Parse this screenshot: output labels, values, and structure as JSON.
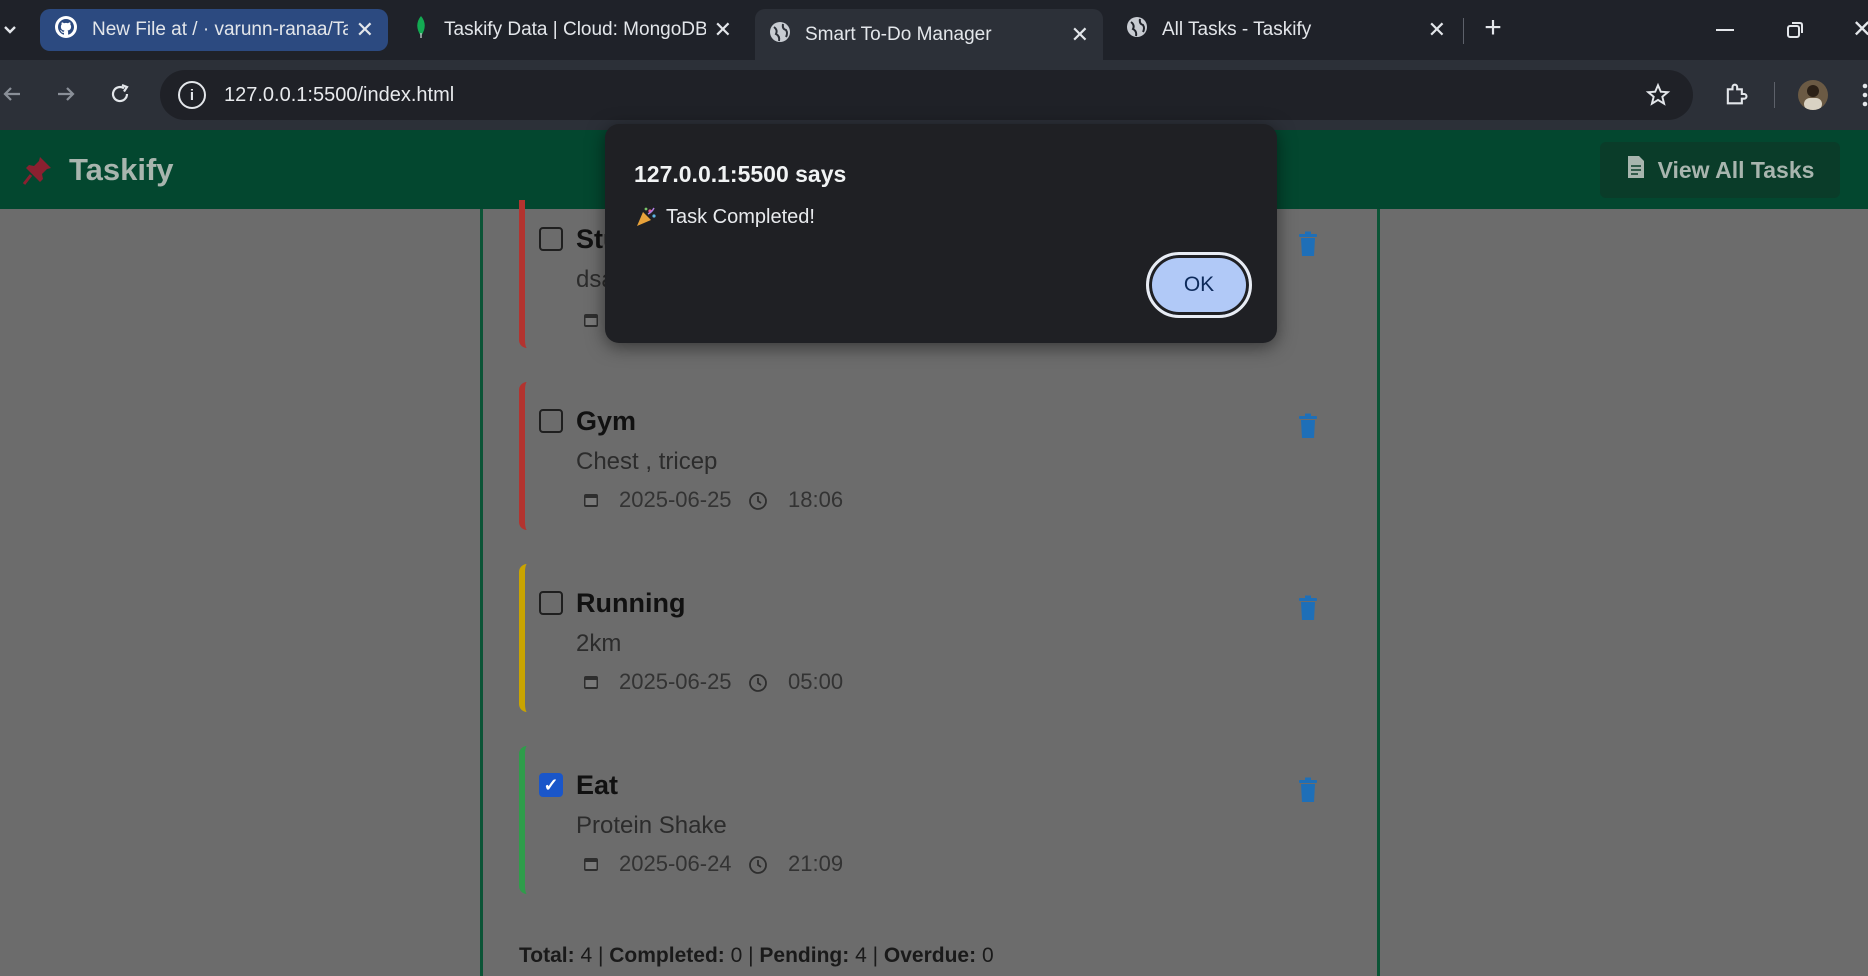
{
  "tabs": [
    {
      "title": "New File at / · varunn-ranaa/Tas",
      "icon": "github-icon",
      "active": false
    },
    {
      "title": "Taskify Data | Cloud: MongoDB",
      "icon": "mongodb-leaf-icon",
      "active": false
    },
    {
      "title": "Smart To-Do Manager",
      "icon": "globe-icon",
      "active": true
    },
    {
      "title": "All Tasks - Taskify",
      "icon": "globe-icon",
      "active": false
    }
  ],
  "address": {
    "url": "127.0.0.1:5500/index.html"
  },
  "header": {
    "brand": "Taskify",
    "brand_icon": "pushpin-icon",
    "view_all_label": "View All Tasks",
    "view_all_icon": "document-icon"
  },
  "tasks": [
    {
      "title": "Stu",
      "desc": "dsa",
      "date": "",
      "time": "",
      "completed": false,
      "priority_color": "#c62828"
    },
    {
      "title": "Gym",
      "desc": "Chest , tricep",
      "date": "2025-06-25",
      "time": "18:06",
      "completed": false,
      "priority_color": "#c62828"
    },
    {
      "title": "Running",
      "desc": "2km",
      "date": "2025-06-25",
      "time": "05:00",
      "completed": false,
      "priority_color": "#c9a400"
    },
    {
      "title": "Eat",
      "desc": "Protein Shake",
      "date": "2025-06-24",
      "time": "21:09",
      "completed": true,
      "priority_color": "#2e9d4a"
    }
  ],
  "stats": {
    "total_label": "Total:",
    "total": "4",
    "completed_label": "Completed:",
    "completed": "0",
    "pending_label": "Pending:",
    "pending": "4",
    "overdue_label": "Overdue:",
    "overdue": "0"
  },
  "dialog": {
    "origin": "127.0.0.1:5500 says",
    "message": "Task Completed!",
    "message_icon": "party-popper-icon",
    "ok_label": "OK"
  },
  "colors": {
    "header": "#03472f",
    "accent_border": "#0b5436",
    "dialog_bg": "#1f2024",
    "ok_button": "#b1c9f7",
    "trash_icon": "#1e6fb8"
  }
}
